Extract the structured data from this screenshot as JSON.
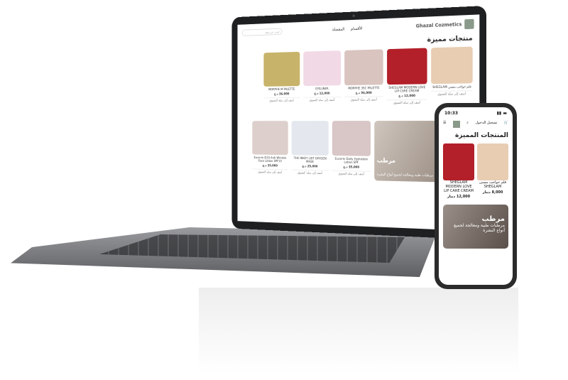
{
  "laptop": {
    "brand": "Ghazal Cozmetics",
    "nav": [
      "الأقسام",
      "المفضلة"
    ],
    "search_placeholder": "ابحث عن منتج",
    "featured_title": "منتجات مميزة",
    "add_to_cart": "أضف إلى سلة التسوق",
    "products": [
      {
        "name": "قلم حواجب مسنن SHEGLAM",
        "price": "",
        "color": "#e8cdb3"
      },
      {
        "name": "SHEGLAM MODERN LOVE LIP CARE CREAM",
        "price": "12,000 د.ع",
        "color": "#b3202a"
      },
      {
        "name": "MORPHE 35C PALETTE",
        "price": "56,000 د.ع",
        "color": "#d9c4c0"
      },
      {
        "name": "EYELINER",
        "price": "12,000 د.ع",
        "color": "#f2d9e6"
      },
      {
        "name": "MORPHE M PALETTE",
        "price": "36,000 د.ع",
        "color": "#c8b36a"
      }
    ],
    "section2_title": "مميزة",
    "banner": {
      "title": "مرطب",
      "subtitle": "مرطبات طبية ومعالجة لجميع أنواع البشرة"
    },
    "products2": [
      {
        "name": "Eucerin Daily Hydration Lotion SPF",
        "price": "35,000 د.ع",
        "color": "#d9c6c6"
      },
      {
        "name": "THE INKEY LIST OXYGEN MASK",
        "price": "25,000 د.ع",
        "color": "#e4e8ee"
      },
      {
        "name": "Eucerin Q10 Anti Wrinkle Face Lotion SPF15",
        "price": "35,000 د.ع",
        "color": "#ddd0cc"
      }
    ]
  },
  "phone": {
    "time": "10:33",
    "login": "تسجيل الدخول",
    "featured_title": "المنتجات المميزة",
    "products": [
      {
        "name": "قلم حواجب مسنن SHEGLAM",
        "price": "8,000 دينار",
        "color": "#e8cdb3"
      },
      {
        "name": "SHEGLAM MODERN LOVE LIP CARE CREAM",
        "price": "12,000 دينار",
        "color": "#b3202a"
      }
    ],
    "banner": {
      "title": "مرطب",
      "subtitle": "مرطبات طبية ومعالجة لجميع أنواع البشرة"
    }
  }
}
